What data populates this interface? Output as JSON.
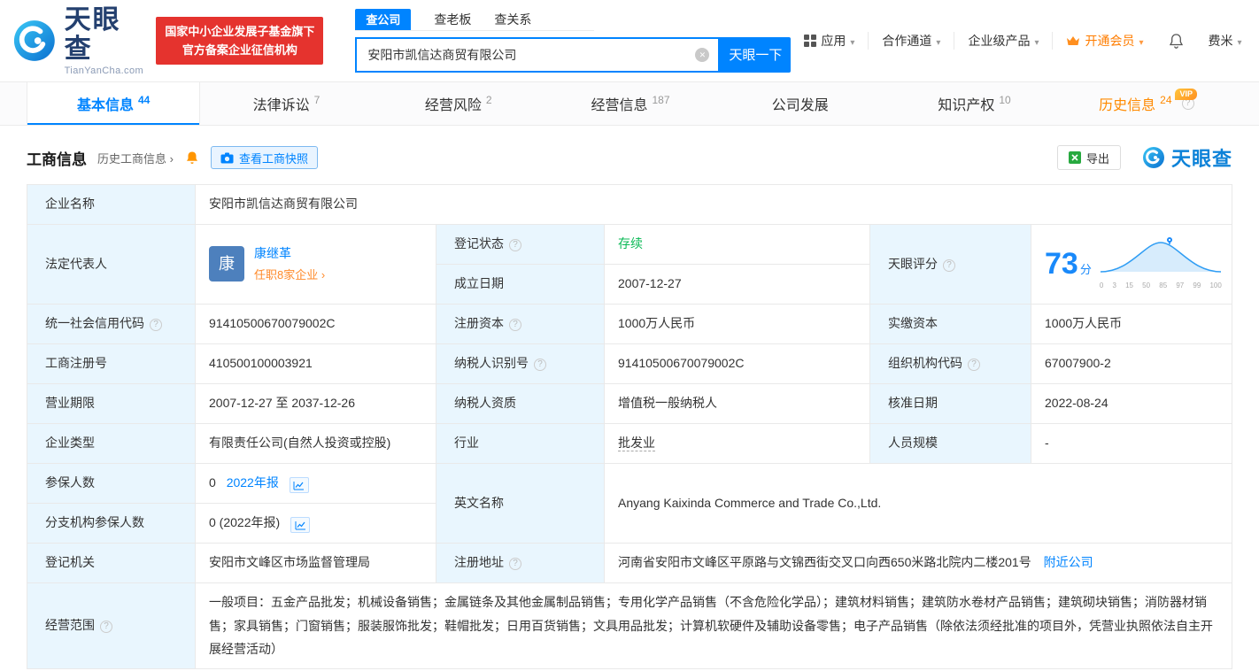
{
  "brand": {
    "name": "天眼查",
    "domain": "TianYanCha.com",
    "badge_line1": "国家中小企业发展子基金旗下",
    "badge_line2": "官方备案企业征信机构",
    "watermark": "天眼查"
  },
  "search": {
    "tabs": [
      {
        "label": "查公司"
      },
      {
        "label": "查老板"
      },
      {
        "label": "查关系"
      }
    ],
    "value": "安阳市凯信达商贸有限公司",
    "button": "天眼一下"
  },
  "nav": {
    "apps": "应用",
    "partner": "合作通道",
    "enterprise": "企业级产品",
    "vip": "开通会员",
    "user": "费米"
  },
  "tabs": [
    {
      "label": "基本信息",
      "count": "44"
    },
    {
      "label": "法律诉讼",
      "count": "7"
    },
    {
      "label": "经营风险",
      "count": "2"
    },
    {
      "label": "经营信息",
      "count": "187"
    },
    {
      "label": "公司发展",
      "count": ""
    },
    {
      "label": "知识产权",
      "count": "10"
    },
    {
      "label": "历史信息",
      "count": "24",
      "vip_badge": "VIP"
    }
  ],
  "section": {
    "title": "工商信息",
    "history_link": "历史工商信息 ›",
    "snapshot_button": "查看工商快照",
    "export_button": "导出"
  },
  "fields": {
    "company_name": {
      "label": "企业名称",
      "value": "安阳市凯信达商贸有限公司"
    },
    "legal_rep": {
      "label": "法定代表人",
      "avatar": "康",
      "name": "康继革",
      "note": "任职8家企业 ›"
    },
    "reg_status": {
      "label": "登记状态",
      "value": "存续"
    },
    "establish_date": {
      "label": "成立日期",
      "value": "2007-12-27"
    },
    "score": {
      "label": "天眼评分",
      "value": "73",
      "unit": "分",
      "axis": [
        "0",
        "3",
        "15",
        "50",
        "85",
        "97",
        "99",
        "100"
      ]
    },
    "credit_code": {
      "label": "统一社会信用代码",
      "value": "91410500670079002C"
    },
    "reg_capital": {
      "label": "注册资本",
      "value": "1000万人民币"
    },
    "paid_capital": {
      "label": "实缴资本",
      "value": "1000万人民币"
    },
    "reg_number": {
      "label": "工商注册号",
      "value": "410500100003921"
    },
    "taxpayer_id": {
      "label": "纳税人识别号",
      "value": "91410500670079002C"
    },
    "org_code": {
      "label": "组织机构代码",
      "value": "67007900-2"
    },
    "business_term": {
      "label": "营业期限",
      "value": "2007-12-27 至 2037-12-26"
    },
    "taxpayer_quality": {
      "label": "纳税人资质",
      "value": "增值税一般纳税人"
    },
    "approval_date": {
      "label": "核准日期",
      "value": "2022-08-24"
    },
    "company_type": {
      "label": "企业类型",
      "value": "有限责任公司(自然人投资或控股)"
    },
    "industry": {
      "label": "行业",
      "value": "批发业"
    },
    "staff_size": {
      "label": "人员规模",
      "value": "-"
    },
    "insured": {
      "label": "参保人数",
      "value": "0",
      "report": "2022年报"
    },
    "english_name": {
      "label": "英文名称",
      "value": "Anyang Kaixinda Commerce and Trade Co.,Ltd."
    },
    "branch_insured": {
      "label": "分支机构参保人数",
      "value": "0 (2022年报)"
    },
    "reg_authority": {
      "label": "登记机关",
      "value": "安阳市文峰区市场监督管理局"
    },
    "reg_address": {
      "label": "注册地址",
      "value": "河南省安阳市文峰区平原路与文锦西街交叉口向西650米路北院内二楼201号",
      "nearby": "附近公司"
    },
    "business_scope": {
      "label": "经营范围",
      "value": "一般项目：五金产品批发；机械设备销售；金属链条及其他金属制品销售；专用化学产品销售（不含危险化学品）；建筑材料销售；建筑防水卷材产品销售；建筑砌块销售；消防器材销售；家具销售；门窗销售；服装服饰批发；鞋帽批发；日用百货销售；文具用品批发；计算机软硬件及辅助设备零售；电子产品销售（除依法须经批准的项目外，凭营业执照依法自主开展经营活动）"
    }
  }
}
